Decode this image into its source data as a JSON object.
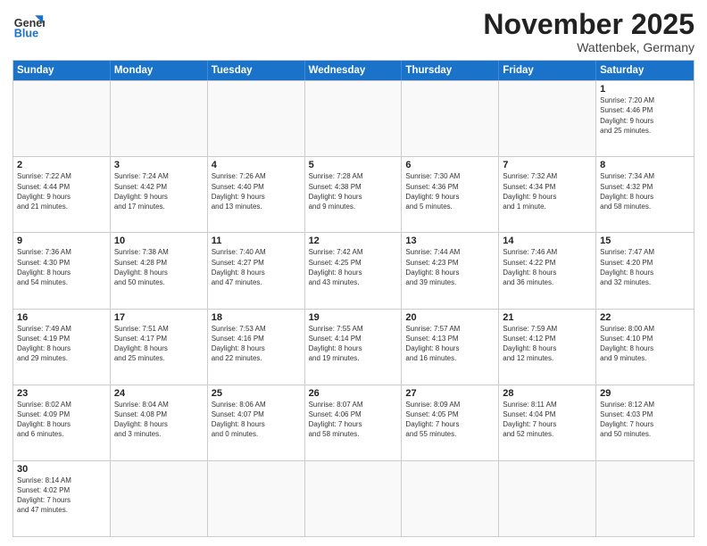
{
  "logo": {
    "general": "General",
    "blue": "Blue"
  },
  "header": {
    "month": "November 2025",
    "location": "Wattenbek, Germany"
  },
  "day_headers": [
    "Sunday",
    "Monday",
    "Tuesday",
    "Wednesday",
    "Thursday",
    "Friday",
    "Saturday"
  ],
  "weeks": [
    {
      "days": [
        {
          "date": "",
          "info": "",
          "empty": true
        },
        {
          "date": "",
          "info": "",
          "empty": true
        },
        {
          "date": "",
          "info": "",
          "empty": true
        },
        {
          "date": "",
          "info": "",
          "empty": true
        },
        {
          "date": "",
          "info": "",
          "empty": true
        },
        {
          "date": "",
          "info": "",
          "empty": true
        },
        {
          "date": "1",
          "info": "Sunrise: 7:20 AM\nSunset: 4:46 PM\nDaylight: 9 hours\nand 25 minutes.",
          "empty": false
        }
      ]
    },
    {
      "days": [
        {
          "date": "2",
          "info": "Sunrise: 7:22 AM\nSunset: 4:44 PM\nDaylight: 9 hours\nand 21 minutes.",
          "empty": false
        },
        {
          "date": "3",
          "info": "Sunrise: 7:24 AM\nSunset: 4:42 PM\nDaylight: 9 hours\nand 17 minutes.",
          "empty": false
        },
        {
          "date": "4",
          "info": "Sunrise: 7:26 AM\nSunset: 4:40 PM\nDaylight: 9 hours\nand 13 minutes.",
          "empty": false
        },
        {
          "date": "5",
          "info": "Sunrise: 7:28 AM\nSunset: 4:38 PM\nDaylight: 9 hours\nand 9 minutes.",
          "empty": false
        },
        {
          "date": "6",
          "info": "Sunrise: 7:30 AM\nSunset: 4:36 PM\nDaylight: 9 hours\nand 5 minutes.",
          "empty": false
        },
        {
          "date": "7",
          "info": "Sunrise: 7:32 AM\nSunset: 4:34 PM\nDaylight: 9 hours\nand 1 minute.",
          "empty": false
        },
        {
          "date": "8",
          "info": "Sunrise: 7:34 AM\nSunset: 4:32 PM\nDaylight: 8 hours\nand 58 minutes.",
          "empty": false
        }
      ]
    },
    {
      "days": [
        {
          "date": "9",
          "info": "Sunrise: 7:36 AM\nSunset: 4:30 PM\nDaylight: 8 hours\nand 54 minutes.",
          "empty": false
        },
        {
          "date": "10",
          "info": "Sunrise: 7:38 AM\nSunset: 4:28 PM\nDaylight: 8 hours\nand 50 minutes.",
          "empty": false
        },
        {
          "date": "11",
          "info": "Sunrise: 7:40 AM\nSunset: 4:27 PM\nDaylight: 8 hours\nand 47 minutes.",
          "empty": false
        },
        {
          "date": "12",
          "info": "Sunrise: 7:42 AM\nSunset: 4:25 PM\nDaylight: 8 hours\nand 43 minutes.",
          "empty": false
        },
        {
          "date": "13",
          "info": "Sunrise: 7:44 AM\nSunset: 4:23 PM\nDaylight: 8 hours\nand 39 minutes.",
          "empty": false
        },
        {
          "date": "14",
          "info": "Sunrise: 7:46 AM\nSunset: 4:22 PM\nDaylight: 8 hours\nand 36 minutes.",
          "empty": false
        },
        {
          "date": "15",
          "info": "Sunrise: 7:47 AM\nSunset: 4:20 PM\nDaylight: 8 hours\nand 32 minutes.",
          "empty": false
        }
      ]
    },
    {
      "days": [
        {
          "date": "16",
          "info": "Sunrise: 7:49 AM\nSunset: 4:19 PM\nDaylight: 8 hours\nand 29 minutes.",
          "empty": false
        },
        {
          "date": "17",
          "info": "Sunrise: 7:51 AM\nSunset: 4:17 PM\nDaylight: 8 hours\nand 25 minutes.",
          "empty": false
        },
        {
          "date": "18",
          "info": "Sunrise: 7:53 AM\nSunset: 4:16 PM\nDaylight: 8 hours\nand 22 minutes.",
          "empty": false
        },
        {
          "date": "19",
          "info": "Sunrise: 7:55 AM\nSunset: 4:14 PM\nDaylight: 8 hours\nand 19 minutes.",
          "empty": false
        },
        {
          "date": "20",
          "info": "Sunrise: 7:57 AM\nSunset: 4:13 PM\nDaylight: 8 hours\nand 16 minutes.",
          "empty": false
        },
        {
          "date": "21",
          "info": "Sunrise: 7:59 AM\nSunset: 4:12 PM\nDaylight: 8 hours\nand 12 minutes.",
          "empty": false
        },
        {
          "date": "22",
          "info": "Sunrise: 8:00 AM\nSunset: 4:10 PM\nDaylight: 8 hours\nand 9 minutes.",
          "empty": false
        }
      ]
    },
    {
      "days": [
        {
          "date": "23",
          "info": "Sunrise: 8:02 AM\nSunset: 4:09 PM\nDaylight: 8 hours\nand 6 minutes.",
          "empty": false
        },
        {
          "date": "24",
          "info": "Sunrise: 8:04 AM\nSunset: 4:08 PM\nDaylight: 8 hours\nand 3 minutes.",
          "empty": false
        },
        {
          "date": "25",
          "info": "Sunrise: 8:06 AM\nSunset: 4:07 PM\nDaylight: 8 hours\nand 0 minutes.",
          "empty": false
        },
        {
          "date": "26",
          "info": "Sunrise: 8:07 AM\nSunset: 4:06 PM\nDaylight: 7 hours\nand 58 minutes.",
          "empty": false
        },
        {
          "date": "27",
          "info": "Sunrise: 8:09 AM\nSunset: 4:05 PM\nDaylight: 7 hours\nand 55 minutes.",
          "empty": false
        },
        {
          "date": "28",
          "info": "Sunrise: 8:11 AM\nSunset: 4:04 PM\nDaylight: 7 hours\nand 52 minutes.",
          "empty": false
        },
        {
          "date": "29",
          "info": "Sunrise: 8:12 AM\nSunset: 4:03 PM\nDaylight: 7 hours\nand 50 minutes.",
          "empty": false
        }
      ]
    },
    {
      "days": [
        {
          "date": "30",
          "info": "Sunrise: 8:14 AM\nSunset: 4:02 PM\nDaylight: 7 hours\nand 47 minutes.",
          "empty": false
        },
        {
          "date": "",
          "info": "",
          "empty": true
        },
        {
          "date": "",
          "info": "",
          "empty": true
        },
        {
          "date": "",
          "info": "",
          "empty": true
        },
        {
          "date": "",
          "info": "",
          "empty": true
        },
        {
          "date": "",
          "info": "",
          "empty": true
        },
        {
          "date": "",
          "info": "",
          "empty": true
        }
      ]
    }
  ]
}
